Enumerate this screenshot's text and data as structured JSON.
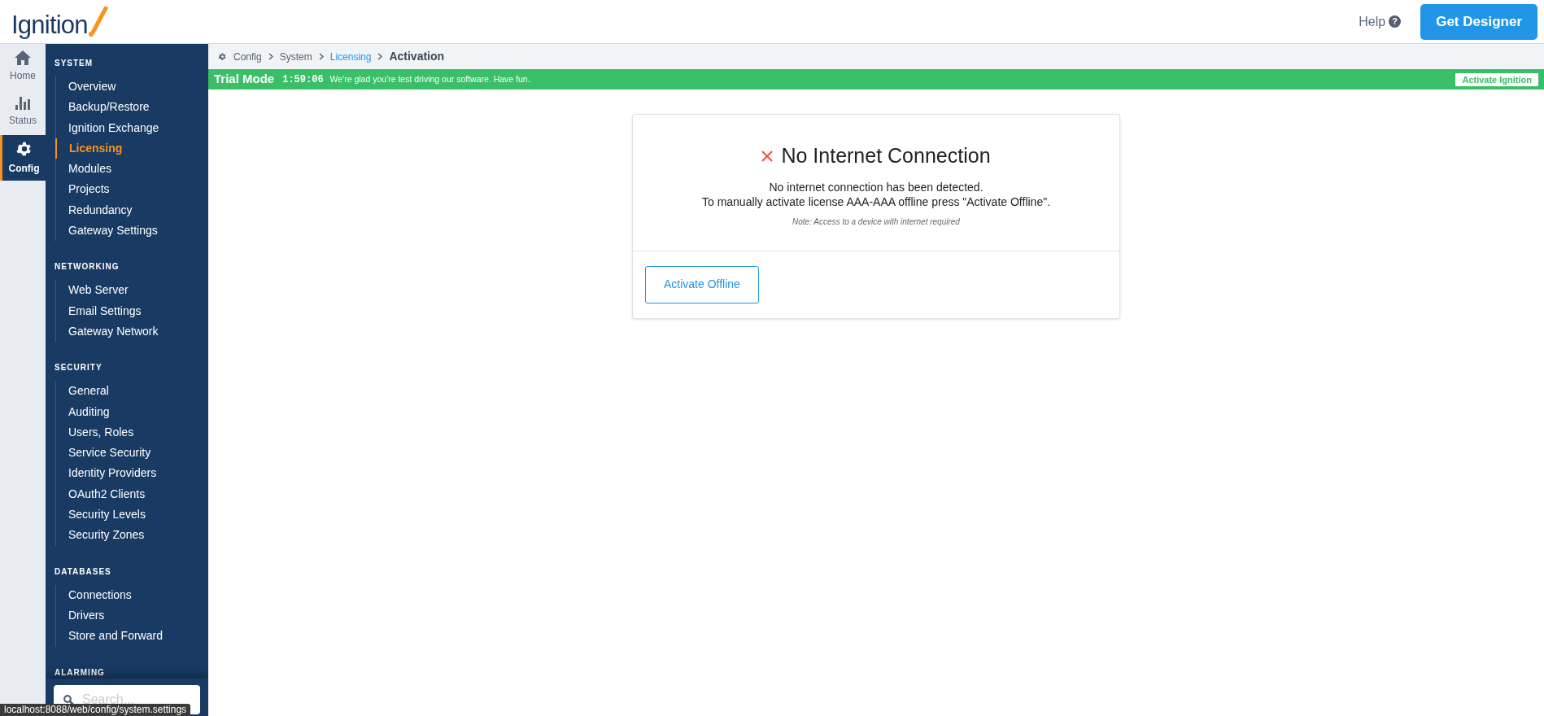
{
  "header": {
    "logo": "Ignition",
    "help": "Help",
    "help_icon": "?",
    "get_designer": "Get Designer"
  },
  "rail": [
    {
      "label": "Home",
      "kind": "home",
      "selected": false
    },
    {
      "label": "Status",
      "kind": "status",
      "selected": false
    },
    {
      "label": "Config",
      "kind": "config",
      "selected": true
    }
  ],
  "nav": [
    {
      "title": "SYSTEM",
      "items": [
        {
          "label": "Overview",
          "selected": false
        },
        {
          "label": "Backup/Restore",
          "selected": false
        },
        {
          "label": "Ignition Exchange",
          "selected": false
        },
        {
          "label": "Licensing",
          "selected": true
        },
        {
          "label": "Modules",
          "selected": false
        },
        {
          "label": "Projects",
          "selected": false
        },
        {
          "label": "Redundancy",
          "selected": false
        },
        {
          "label": "Gateway Settings",
          "selected": false
        }
      ]
    },
    {
      "title": "NETWORKING",
      "items": [
        {
          "label": "Web Server",
          "selected": false
        },
        {
          "label": "Email Settings",
          "selected": false
        },
        {
          "label": "Gateway Network",
          "selected": false
        }
      ]
    },
    {
      "title": "SECURITY",
      "items": [
        {
          "label": "General",
          "selected": false
        },
        {
          "label": "Auditing",
          "selected": false
        },
        {
          "label": "Users, Roles",
          "selected": false
        },
        {
          "label": "Service Security",
          "selected": false
        },
        {
          "label": "Identity Providers",
          "selected": false
        },
        {
          "label": "OAuth2 Clients",
          "selected": false
        },
        {
          "label": "Security Levels",
          "selected": false
        },
        {
          "label": "Security Zones",
          "selected": false
        }
      ]
    },
    {
      "title": "DATABASES",
      "items": [
        {
          "label": "Connections",
          "selected": false
        },
        {
          "label": "Drivers",
          "selected": false
        },
        {
          "label": "Store and Forward",
          "selected": false
        }
      ]
    },
    {
      "title": "ALARMING"
    }
  ],
  "search": {
    "placeholder": "Search..."
  },
  "breadcrumb": [
    {
      "label": "Config",
      "kind": "root"
    },
    {
      "label": "System",
      "kind": "plain"
    },
    {
      "label": "Licensing",
      "kind": "link"
    },
    {
      "label": "Activation",
      "kind": "current"
    }
  ],
  "trial_banner": {
    "title": "Trial Mode",
    "time": "1:59:06",
    "message": "We're glad you're test driving our software. Have fun.",
    "button": "Activate Ignition"
  },
  "card": {
    "title": "No Internet Connection",
    "lines": [
      "No internet connection has been detected.",
      "To manually activate license AAA-AAA offline press \"Activate Offline\"."
    ],
    "note": "Note: Access to a device with internet required",
    "button": "Activate Offline"
  },
  "status_url": "localhost:8088/web/config/system.settings"
}
